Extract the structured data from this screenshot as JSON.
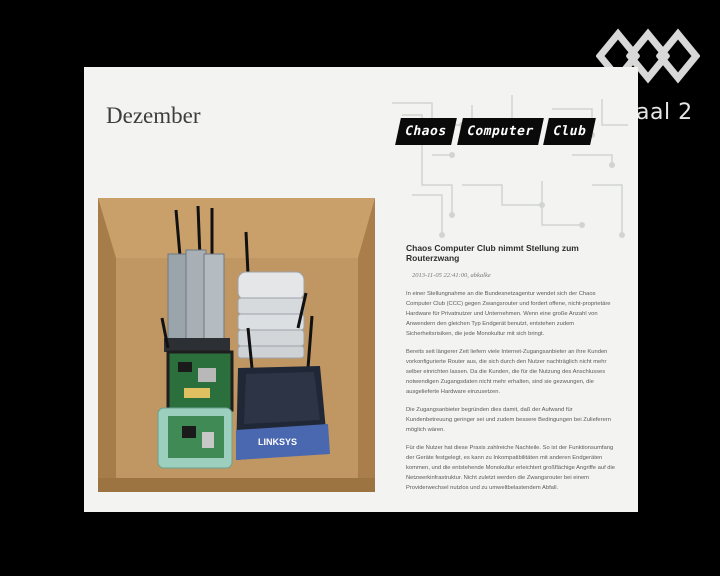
{
  "overlay": {
    "room_label": "aal 2"
  },
  "slide": {
    "title": "Dezember",
    "banner": {
      "words": [
        "Chaos",
        "Computer",
        "Club"
      ]
    },
    "article": {
      "title": "Chaos Computer Club nimmt Stellung zum Routerzwang",
      "date": "2013-11-05 22:41:00, abkalke",
      "paragraphs": [
        "In einer Stellungnahme an die Bundesnetzagentur wendet sich der Chaos Computer Club (CCC) gegen Zwangsrouter und fordert offene, nicht-proprietäre Hardware für Privatnutzer und Unternehmen. Wenn eine große Anzahl von Anwendern den gleichen Typ Endgerät benutzt, entstehen zudem Sicherheitsrisiken, die jede Monokultur mit sich bringt.",
        "Bereits seit längerer Zeit liefern viele Internet-Zugangsanbieter an ihre Kunden vorkonfigurierte Router aus, die sich durch den Nutzer nachträglich nicht mehr selber einrichten lassen. Da die Kunden, die für die Nutzung des Anschlusses notwendigen Zugangsdaten nicht mehr erhalten, sind sie gezwungen, die ausgelieferte Hardware einzusetzen.",
        "Die Zugangsanbieter begründen dies damit, daß der Aufwand für Kundenbetreuung geringer sei und zudem bessere Bedingungen bei Zulieferern möglich wären.",
        "Für die Nutzer hat diese Praxis zahlreiche Nachteile. So ist der Funktionsumfang der Geräte festgelegt, es kann zu Inkompatibilitäten mit anderen Endgeräten kommen, und die entstehende Monokultur erleichtert großflächige Angriffe auf die Netzwerkinfrastruktur. Nicht zuletzt werden die Zwangsrouter bei einem Providerwechsel nutzlos und zu umweltbelastendem Abfall."
      ]
    },
    "photo": {
      "brand_label": "LINKSYS"
    }
  }
}
